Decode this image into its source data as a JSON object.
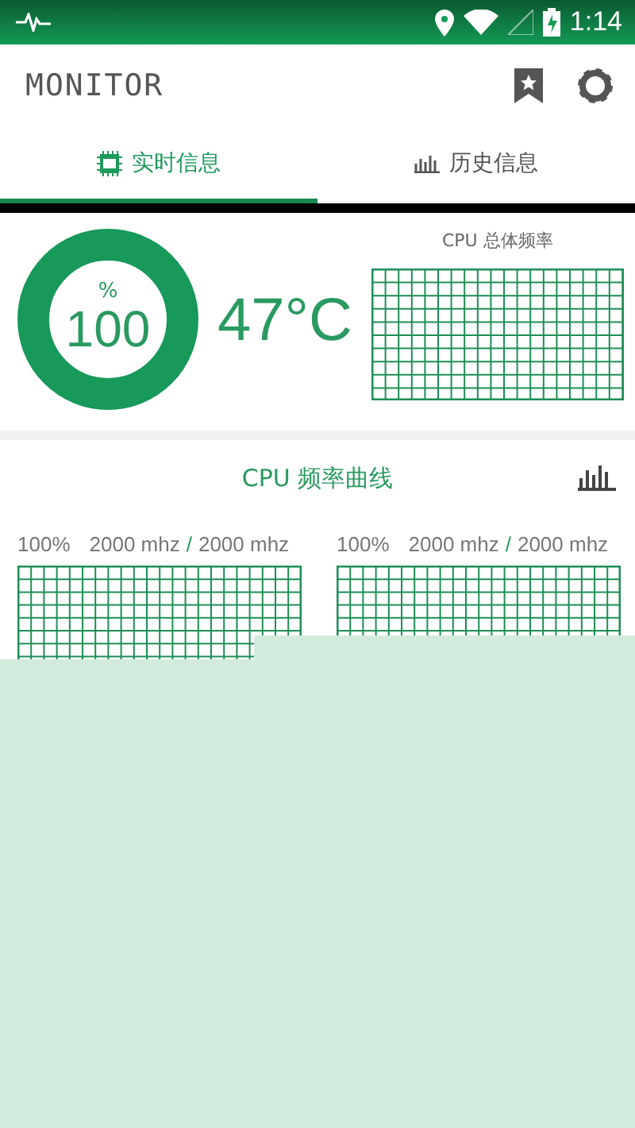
{
  "status_bar": {
    "time": "1:14"
  },
  "app_bar": {
    "title": "MONITOR"
  },
  "tabs": [
    {
      "label": "实时信息",
      "selected": true
    },
    {
      "label": "历史信息",
      "selected": false
    }
  ],
  "overview": {
    "usage": {
      "unit": "%",
      "value": "100"
    },
    "temperature": "47°C",
    "chart_title": "CPU 总体频率"
  },
  "curves": {
    "title": "CPU 频率曲线",
    "cores": [
      {
        "percent": "100%",
        "current": "2000 mhz",
        "separator": "/",
        "max": "2000 mhz"
      },
      {
        "percent": "100%",
        "current": "2000 mhz",
        "separator": "/",
        "max": "2000 mhz"
      }
    ]
  }
}
